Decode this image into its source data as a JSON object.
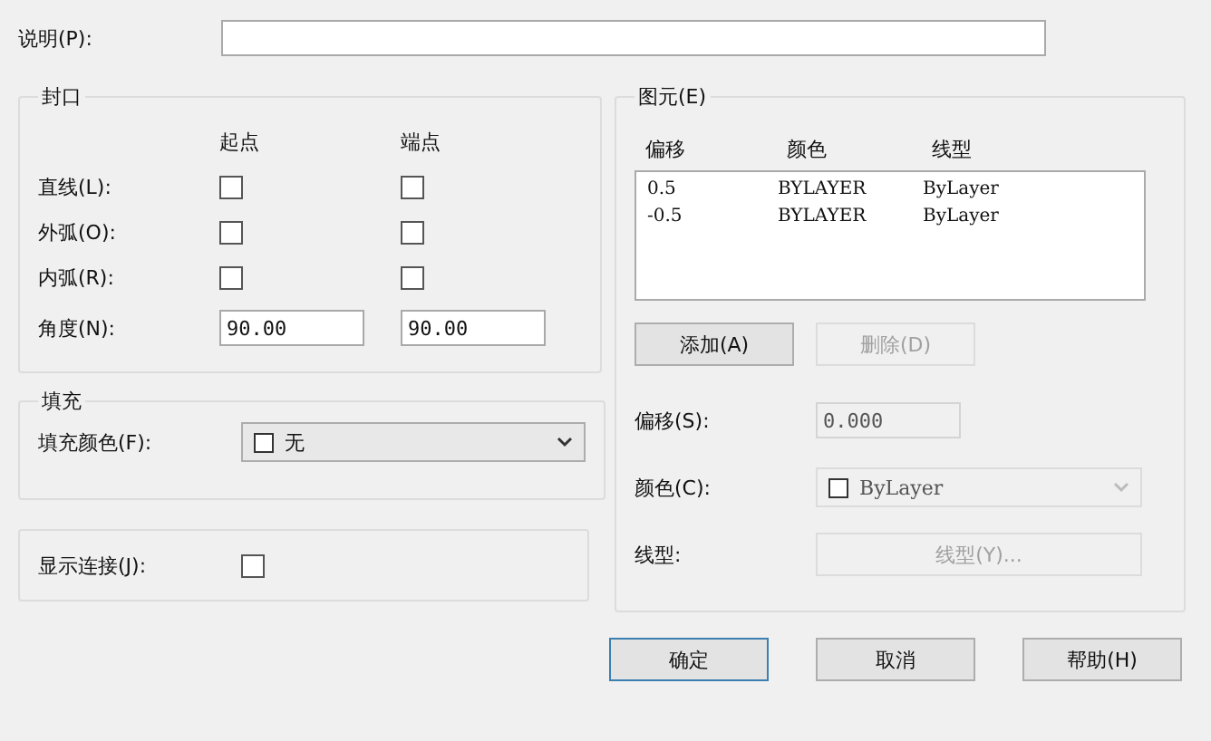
{
  "description": {
    "label": "说明(P):"
  },
  "caps": {
    "title": "封口",
    "columns": [
      "起点",
      "端点"
    ],
    "rows": [
      {
        "kind": "check",
        "label": "直线(L):",
        "start_checked": false,
        "end_checked": false
      },
      {
        "kind": "check",
        "label": "外弧(O):",
        "start_checked": false,
        "end_checked": false
      },
      {
        "kind": "check",
        "label": "内弧(R):",
        "start_checked": false,
        "end_checked": false
      },
      {
        "kind": "text",
        "label": "角度(N):",
        "start": "90.00",
        "end": "90.00"
      }
    ]
  },
  "fill": {
    "title": "填充",
    "label": "填充颜色(F):",
    "value": "无"
  },
  "show_joints": {
    "label": "显示连接(J):",
    "checked": false
  },
  "elements": {
    "title": "图元(E)",
    "columns": [
      "偏移",
      "颜色",
      "线型"
    ],
    "rows": [
      [
        "0.5",
        "BYLAYER",
        "ByLayer"
      ],
      [
        "-0.5",
        "BYLAYER",
        "ByLayer"
      ]
    ],
    "buttons": [
      {
        "label": "添加(A)",
        "disabled": false
      },
      {
        "label": "删除(D)",
        "disabled": true
      }
    ],
    "offset": {
      "label": "偏移(S):",
      "value": "0.000",
      "disabled": true
    },
    "color": {
      "label": "颜色(C):",
      "value": "ByLayer",
      "disabled": true
    },
    "linetype": {
      "label": "线型:",
      "button": "线型(Y)...",
      "disabled": true
    }
  },
  "footer": [
    {
      "label": "确定",
      "default": true
    },
    {
      "label": "取消",
      "default": false
    },
    {
      "label": "帮助(H)",
      "default": false
    }
  ]
}
